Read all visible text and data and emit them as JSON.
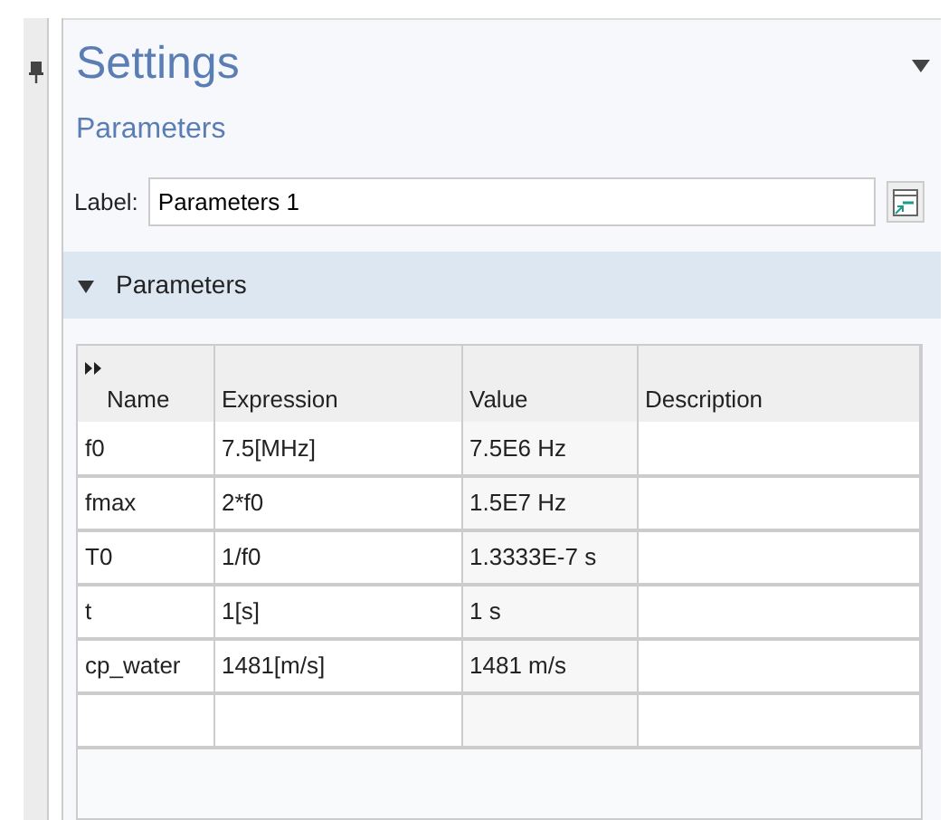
{
  "title": "Settings",
  "subtitle": "Parameters",
  "label_field": {
    "label": "Label:",
    "value": "Parameters 1"
  },
  "section": {
    "title": "Parameters",
    "expanded": true
  },
  "table": {
    "columns": [
      "Name",
      "Expression",
      "Value",
      "Description"
    ],
    "rows": [
      {
        "name": "f0",
        "expression": "7.5[MHz]",
        "value": "7.5E6 Hz"
      },
      {
        "name": "fmax",
        "expression": "2*f0",
        "value": "1.5E7 Hz"
      },
      {
        "name": "T0",
        "expression": "1/f0",
        "value": "1.3333E-7 s"
      },
      {
        "name": "t",
        "expression": "1[s]",
        "value": "1 s"
      },
      {
        "name": "cp_water",
        "expression": "1481[m/s]",
        "value": "1481 m/s"
      }
    ]
  }
}
